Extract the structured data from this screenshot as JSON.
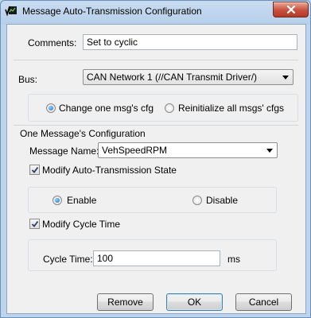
{
  "window": {
    "title": "Message Auto-Transmission Configuration",
    "app_icon": "vector-chart-icon",
    "close_icon": "close-icon"
  },
  "comments": {
    "label": "Comments:",
    "value": "Set to cyclic"
  },
  "bus": {
    "label": "Bus:",
    "selected": "CAN Network 1 (//CAN Transmit Driver/)"
  },
  "mode": {
    "option_one": "Change one msg's cfg",
    "option_all": "Reinitialize all msgs' cfgs",
    "selected": "option_one"
  },
  "one_message": {
    "group_title": "One Message's Configuration",
    "message_name_label": "Message Name:",
    "message_name_value": "VehSpeedRPM",
    "modify_state_label": "Modify Auto-Transmission State",
    "modify_state_checked": true,
    "enable_label": "Enable",
    "disable_label": "Disable",
    "state_selected": "enable",
    "modify_cycle_label": "Modify Cycle Time",
    "modify_cycle_checked": true,
    "cycle_time_label": "Cycle Time:",
    "cycle_time_value": "100",
    "cycle_time_unit": "ms"
  },
  "buttons": {
    "remove": "Remove",
    "ok": "OK",
    "cancel": "Cancel"
  },
  "colors": {
    "radio_selected": "#1a6fc4",
    "close_button": "#c7503c",
    "title_bar": "#bcd4ec"
  }
}
